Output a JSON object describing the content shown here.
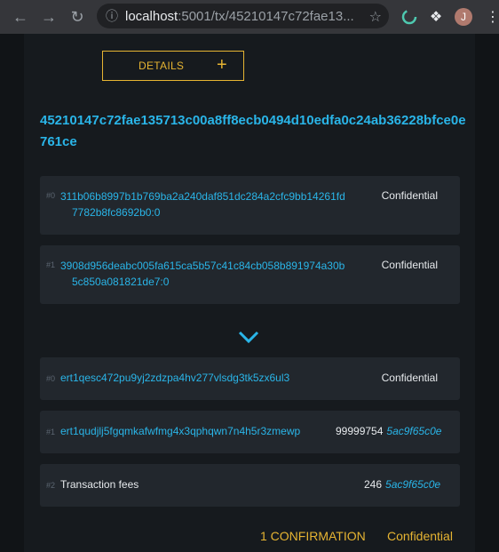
{
  "browser": {
    "url_host": "localhost",
    "url_rest": ":5001/tx/45210147c72fae13...",
    "avatar_initial": "J"
  },
  "details_button": {
    "label": "DETAILS",
    "icon": "+"
  },
  "transaction": {
    "txid": "45210147c72fae135713c00a8ff8ecb0494d10edfa0c24ab36228bfce0e761ce"
  },
  "inputs": [
    {
      "index": "#0",
      "line1": "311b06b8997b1b769ba2a240daf851dc284a2cfc9bb14261fd",
      "line2": "7782b8fc8692b0:0",
      "value": "Confidential"
    },
    {
      "index": "#1",
      "line1": "3908d956deabc005fa615ca5b57c41c84cb058b891974a30b",
      "line2": "5c850a081821de7:0",
      "value": "Confidential"
    }
  ],
  "outputs": [
    {
      "index": "#0",
      "address": "ert1qesc472pu9yj2zdzpa4hv277vlsdg3tk5zx6ul3",
      "value": "Confidential"
    },
    {
      "index": "#1",
      "address": "ert1qudjlj5fgqmkafwfmg4x3qphqwn7n4h5r3zmewp",
      "amount": "99999754",
      "asset": "5ac9f65c0e"
    },
    {
      "index": "#2",
      "label": "Transaction fees",
      "amount": "246",
      "asset": "5ac9f65c0e"
    }
  ],
  "footer": {
    "confirmations": "1 CONFIRMATION",
    "status": "Confidential"
  }
}
